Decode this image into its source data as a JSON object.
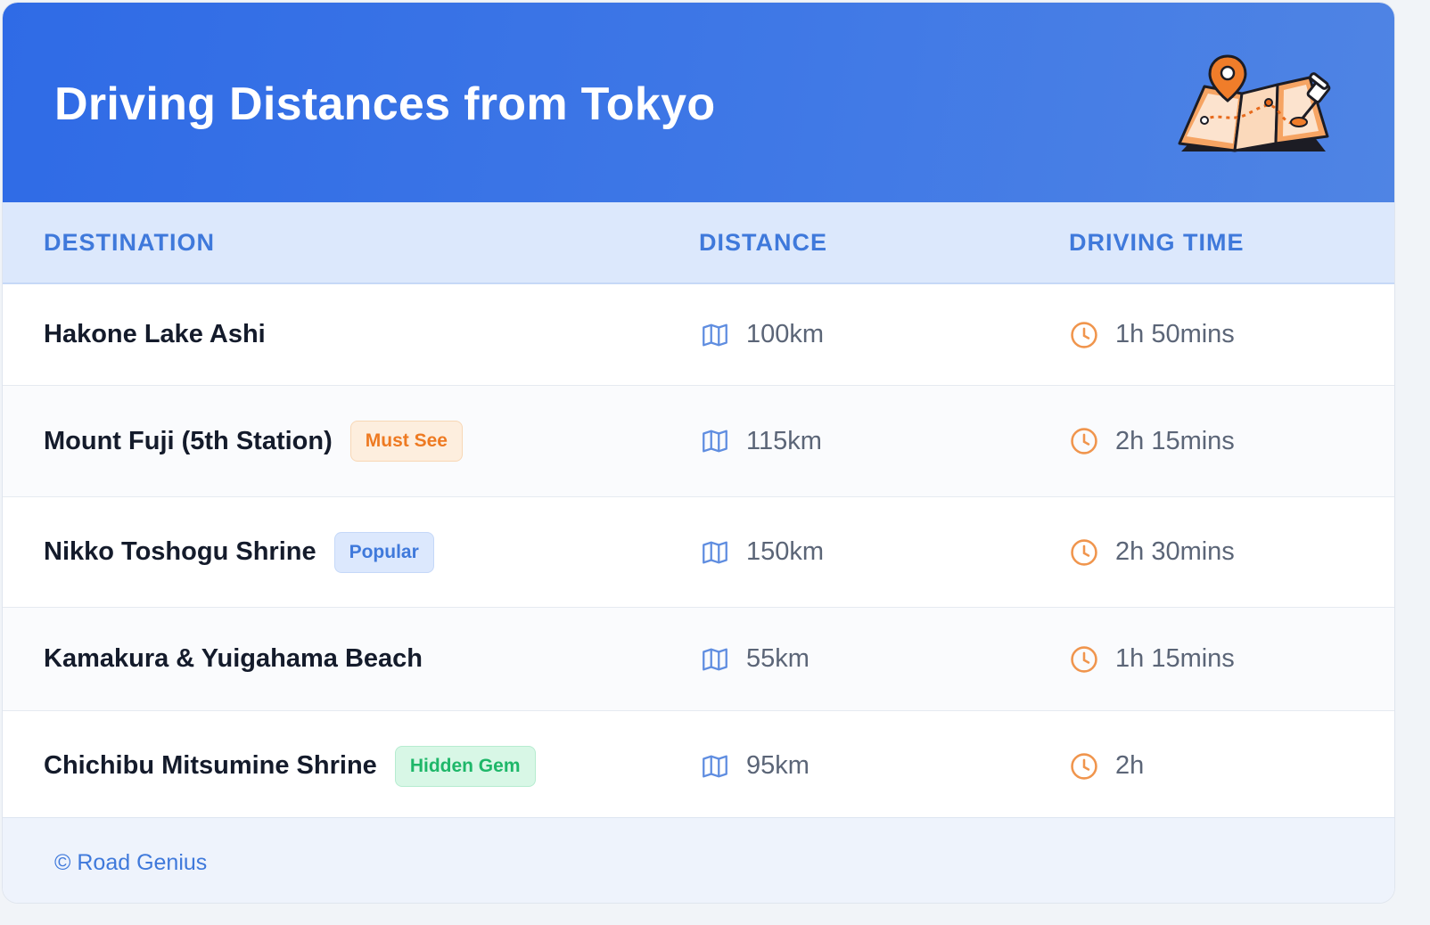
{
  "title": "Driving Distances from Tokyo",
  "columns": {
    "destination": "DESTINATION",
    "distance": "DISTANCE",
    "driving_time": "DRIVING TIME"
  },
  "rows": [
    {
      "destination": "Hakone Lake Ashi",
      "badge": "",
      "distance": "100km",
      "time": "1h 50mins"
    },
    {
      "destination": "Mount Fuji (5th Station)",
      "badge": "Must See",
      "badge_color": "#ee7a22",
      "distance": "115km",
      "time": "2h 15mins"
    },
    {
      "destination": "Nikko Toshogu Shrine",
      "badge": "Popular",
      "badge_color": "#3f79db",
      "distance": "150km",
      "time": "2h 30mins"
    },
    {
      "destination": "Kamakura & Yuigahama Beach",
      "badge": "",
      "distance": "55km",
      "time": "1h 15mins"
    },
    {
      "destination": "Chichibu Mitsumine Shrine",
      "badge": "Hidden Gem",
      "badge_color": "#1eb769",
      "distance": "95km",
      "time": "2h"
    }
  ],
  "footer": "© Road Genius",
  "icons": {
    "header": "folded-map-with-pins-icon",
    "distance": "map-icon",
    "time": "clock-icon"
  },
  "colors": {
    "header_bg": "#3a72e6",
    "accent": "#3f79db",
    "clock": "#f0954d"
  }
}
